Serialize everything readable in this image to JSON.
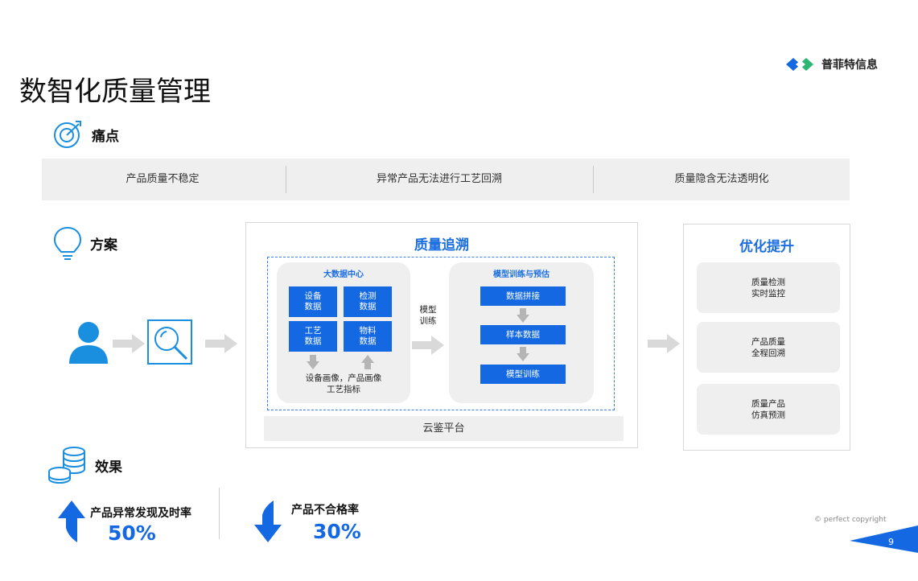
{
  "title": "数智化质量管理",
  "brand": {
    "name": "普菲特信息"
  },
  "sections": {
    "pain": "痛点",
    "solution": "方案",
    "effect": "效果"
  },
  "pain_points": [
    "产品质量不稳定",
    "异常产品无法进行工艺回溯",
    "质量隐含无法透明化"
  ],
  "trace": {
    "title": "质量追溯",
    "big_data": {
      "title": "大数据中心",
      "items": [
        "设备\n数据",
        "检测\n数据",
        "工艺\n数据",
        "物料\n数据"
      ],
      "caption_line1": "设备画像，产品画像",
      "caption_line2": "工艺指标"
    },
    "model_label_line1": "模型",
    "model_label_line2": "训练",
    "model": {
      "title": "模型训练与预估",
      "steps": [
        "数据拼接",
        "样本数据",
        "模型训练"
      ]
    },
    "platform": "云鉴平台"
  },
  "optimize": {
    "title": "优化提升",
    "cards": [
      "质量检测\n实时监控",
      "产品质量\n全程回溯",
      "质量产品\n仿真预测"
    ]
  },
  "effects": [
    {
      "label": "产品异常发现及时率",
      "value": "50%",
      "direction": "up"
    },
    {
      "label": "产品不合格率",
      "value": "30%",
      "direction": "down"
    }
  ],
  "footer": {
    "copyright": "© perfect copyright",
    "page_number": "9"
  },
  "colors": {
    "accent": "#1469e3",
    "title_blue": "#1a6ee0",
    "panel_gray": "#efefef",
    "arrow_gray": "#d9d9d9"
  }
}
